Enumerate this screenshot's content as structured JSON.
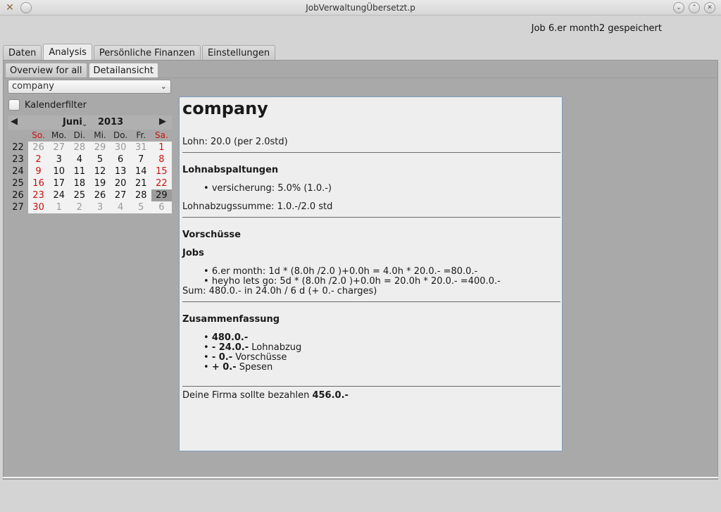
{
  "window": {
    "title": "JobVerwaltungÜbersetzt.p"
  },
  "status_text": "Job 6.er month2 gespeichert",
  "tabs": [
    "Daten",
    "Analysis",
    "Persönliche Finanzen",
    "Einstellungen"
  ],
  "subtabs": [
    "Overview for all",
    "Detailansicht"
  ],
  "dropdown": {
    "value": "company"
  },
  "filter": {
    "label": "Kalenderfilter"
  },
  "calendar": {
    "month": "Juni",
    "year": "2013",
    "weekdays": [
      "So.",
      "Mo.",
      "Di.",
      "Mi.",
      "Do.",
      "Fr.",
      "Sa."
    ],
    "weeks": [
      {
        "num": "22",
        "days": [
          "26",
          "27",
          "28",
          "29",
          "30",
          "31",
          "1"
        ]
      },
      {
        "num": "23",
        "days": [
          "2",
          "3",
          "4",
          "5",
          "6",
          "7",
          "8"
        ]
      },
      {
        "num": "24",
        "days": [
          "9",
          "10",
          "11",
          "12",
          "13",
          "14",
          "15"
        ]
      },
      {
        "num": "25",
        "days": [
          "16",
          "17",
          "18",
          "19",
          "20",
          "21",
          "22"
        ]
      },
      {
        "num": "26",
        "days": [
          "23",
          "24",
          "25",
          "26",
          "27",
          "28",
          "29"
        ]
      },
      {
        "num": "27",
        "days": [
          "30",
          "1",
          "2",
          "3",
          "4",
          "5",
          "6"
        ]
      }
    ],
    "selected_day": "29"
  },
  "report": {
    "title": "company",
    "lohn": "Lohn: 20.0 (per 2.0std)",
    "lohnabspaltungen_head": "Lohnabspaltungen",
    "lohnabspaltungen_item": "versicherung: 5.0% (1.0.-)",
    "lohnabzugssumme": "Lohnabzugssumme: 1.0.-/2.0 std",
    "vorschuesse_head": "Vorschüsse",
    "jobs_head": "Jobs",
    "jobs": [
      "6.er month: 1d * (8.0h /2.0 )+0.0h = 4.0h * 20.0.- =80.0.-",
      "heyho lets go: 5d * (8.0h /2.0 )+0.0h = 20.0h * 20.0.- =400.0.-"
    ],
    "sum": "Sum: 480.0.- in 24.0h / 6 d (+ 0.- charges)",
    "zusammenfassung_head": "Zusammenfassung",
    "summary": [
      {
        "value": "480.0.-",
        "label": ""
      },
      {
        "value": "- 24.0.-",
        "label": "Lohnabzug"
      },
      {
        "value": "- 0.-",
        "label": "Vorschüsse"
      },
      {
        "value": "+  0.-",
        "label": "Spesen"
      }
    ],
    "final_label": "Deine Firma sollte bezahlen",
    "final_value": "456.0.-"
  }
}
